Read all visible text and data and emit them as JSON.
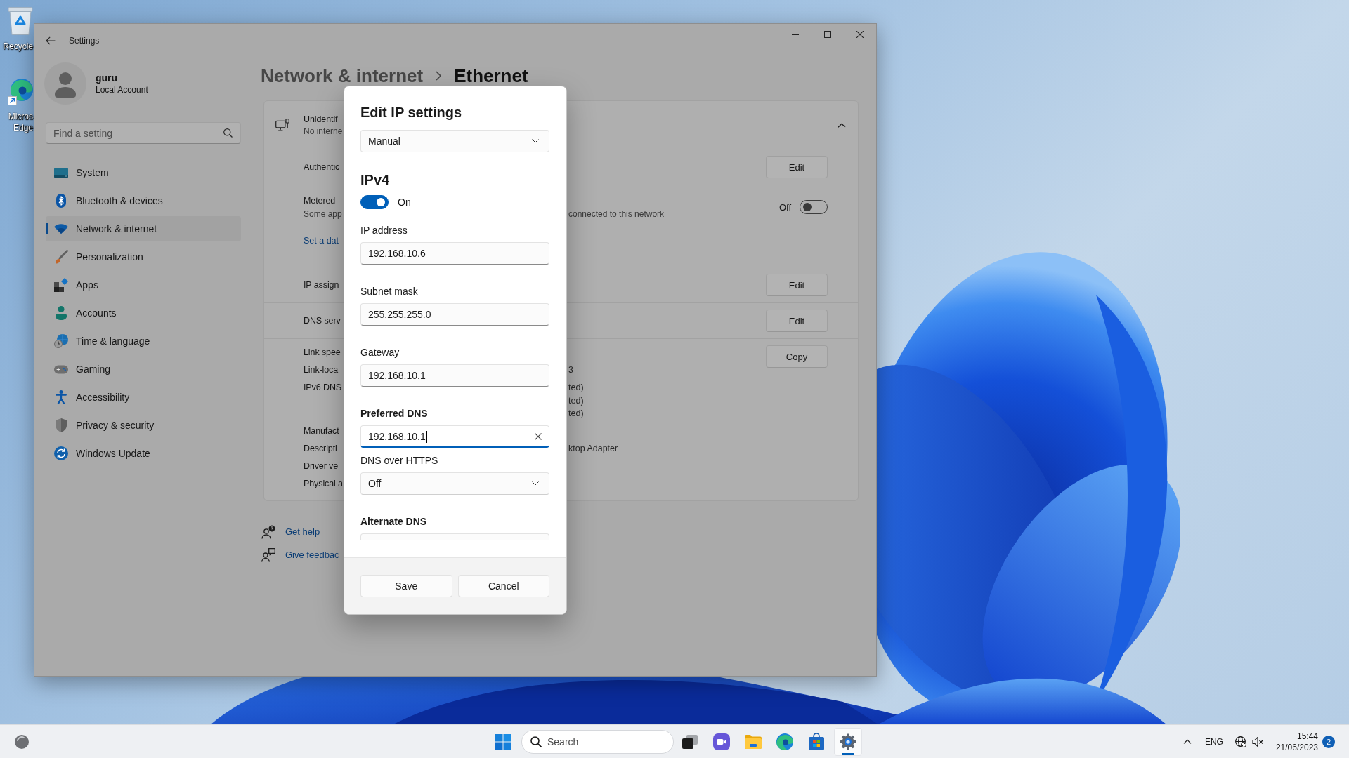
{
  "desktop": {
    "icons": [
      {
        "kind": "recycle-bin",
        "lines": [
          "Recycle"
        ]
      },
      {
        "kind": "browser",
        "lines": [
          "Micros",
          "Edge"
        ]
      }
    ]
  },
  "window": {
    "title": "Settings"
  },
  "account": {
    "name": "guru",
    "type": "Local Account"
  },
  "search": {
    "placeholder": "Find a setting"
  },
  "sidebar": {
    "items": [
      {
        "label": "System",
        "kind": "system",
        "selected": false
      },
      {
        "label": "Bluetooth & devices",
        "kind": "bluetooth",
        "selected": false
      },
      {
        "label": "Network & internet",
        "kind": "network",
        "selected": true
      },
      {
        "label": "Personalization",
        "kind": "personalization",
        "selected": false
      },
      {
        "label": "Apps",
        "kind": "apps",
        "selected": false
      },
      {
        "label": "Accounts",
        "kind": "accounts",
        "selected": false
      },
      {
        "label": "Time & language",
        "kind": "time",
        "selected": false
      },
      {
        "label": "Gaming",
        "kind": "gaming",
        "selected": false
      },
      {
        "label": "Accessibility",
        "kind": "accessibility",
        "selected": false
      },
      {
        "label": "Privacy & security",
        "kind": "privacy",
        "selected": false
      },
      {
        "label": "Windows Update",
        "kind": "update",
        "selected": false
      }
    ]
  },
  "breadcrumb": [
    "Network & internet",
    "Ethernet"
  ],
  "card": {
    "header": {
      "title": "Unidentif",
      "subtitle": "No interne",
      "expanded": true
    },
    "rows": [
      {
        "kind": "action",
        "label": "Authentic",
        "button": "Edit"
      },
      {
        "kind": "toggle",
        "label": "Metered",
        "description": "Some app",
        "description_tail": "connected to this network",
        "link": "Set a dat",
        "state_label": "Off",
        "on": false
      },
      {
        "kind": "action",
        "label": "IP assign",
        "button": "Edit"
      },
      {
        "kind": "action",
        "label": "DNS serv",
        "button": "Edit"
      },
      {
        "kind": "properties",
        "button": "Copy",
        "items": [
          {
            "label": "Link spee"
          },
          {
            "label": "Link-loca",
            "values": [
              "3"
            ]
          },
          {
            "label": "IPv6 DNS",
            "values": [
              "ted)",
              "ted)",
              "ted)"
            ]
          },
          {
            "label": "Manufact"
          },
          {
            "label": "Descripti",
            "values": [
              "ktop Adapter"
            ]
          },
          {
            "label": "Driver ve"
          },
          {
            "label": "Physical a"
          }
        ]
      }
    ]
  },
  "help_links": [
    {
      "label": "Get help",
      "kind": "help"
    },
    {
      "label": "Give feedbac",
      "kind": "feedback"
    }
  ],
  "dialog": {
    "title": "Edit IP settings",
    "mode": "Manual",
    "section": "IPv4",
    "ipv4_toggle": {
      "on": true,
      "label": "On"
    },
    "fields": [
      {
        "label": "IP address",
        "bold": false,
        "value": "192.168.10.6",
        "focused": false,
        "cut_off": false
      },
      {
        "label": "Subnet mask",
        "bold": false,
        "value": "255.255.255.0",
        "focused": false,
        "cut_off": false
      },
      {
        "label": "Gateway",
        "bold": false,
        "value": "192.168.10.1",
        "focused": false,
        "cut_off": false
      },
      {
        "label": "Preferred DNS",
        "bold": true,
        "value": "192.168.10.1",
        "focused": true,
        "cut_off": false,
        "dns_over_https": {
          "label": "DNS over HTTPS",
          "value": "Off"
        }
      },
      {
        "label": "Alternate DNS",
        "bold": true,
        "focused": false,
        "cut_off": true
      }
    ],
    "buttons": [
      "Save",
      "Cancel"
    ]
  },
  "taskbar": {
    "search": {
      "placeholder": "Search"
    },
    "apps": [
      {
        "kind": "task-view",
        "selected": false
      },
      {
        "kind": "chat",
        "selected": false
      },
      {
        "kind": "explorer",
        "selected": false
      },
      {
        "kind": "browser",
        "selected": false
      },
      {
        "kind": "store",
        "selected": false
      },
      {
        "kind": "settings",
        "selected": true
      }
    ],
    "language": "ENG",
    "time": "15:44",
    "date": "21/06/2023",
    "notification_count": "2"
  }
}
